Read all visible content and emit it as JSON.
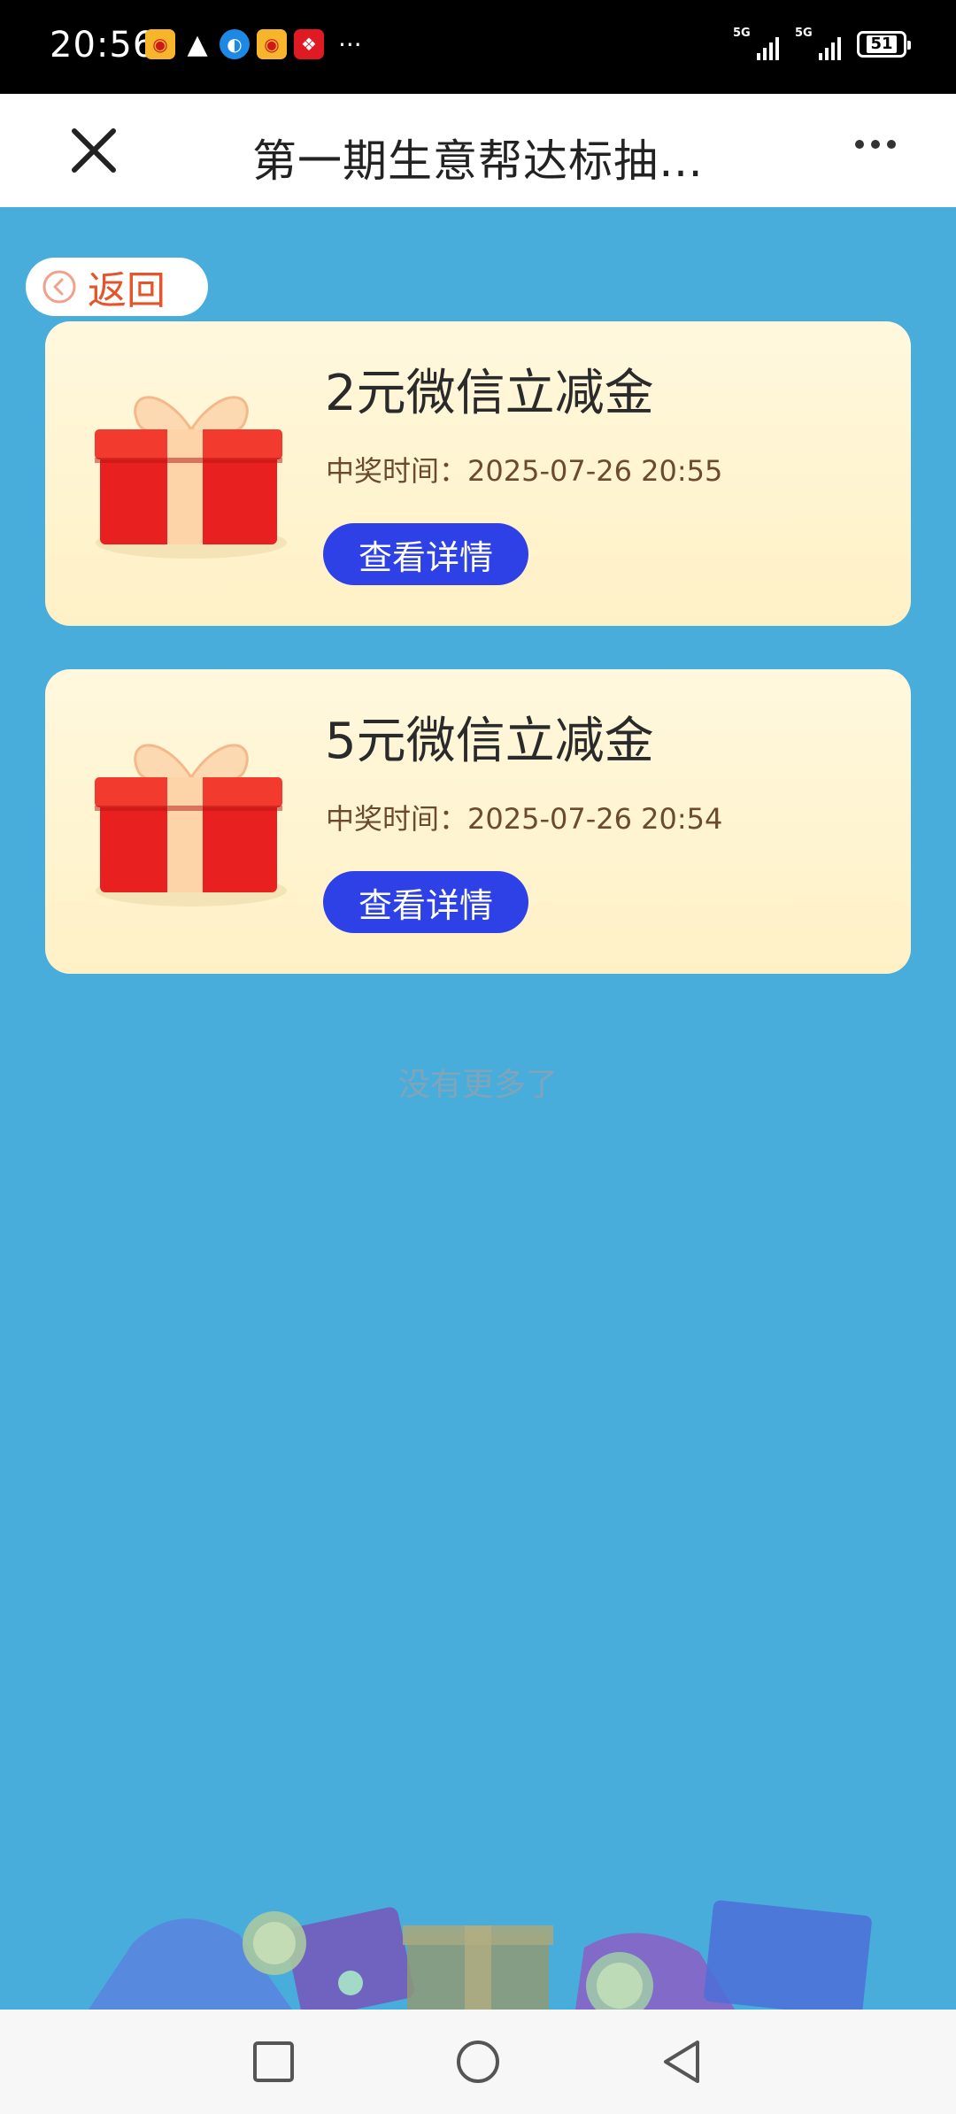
{
  "status_bar": {
    "time": "20:56",
    "network_1": "5G",
    "network_2": "5G",
    "battery": "51",
    "more": "···"
  },
  "header": {
    "title": "第一期生意帮达标抽…"
  },
  "back": {
    "label": "返回"
  },
  "prizes": [
    {
      "name": "2元微信立减金",
      "time_label": "中奖时间：",
      "time_value": "2025-07-26 20:55",
      "button": "查看详情"
    },
    {
      "name": "5元微信立减金",
      "time_label": "中奖时间：",
      "time_value": "2025-07-26 20:54",
      "button": "查看详情"
    }
  ],
  "footer_note": "没有更多了",
  "colors": {
    "page_bg": "#49ADDC",
    "card_bg": "#FFF5D6",
    "button_bg": "#2D41E6",
    "back_text": "#E3552B"
  }
}
